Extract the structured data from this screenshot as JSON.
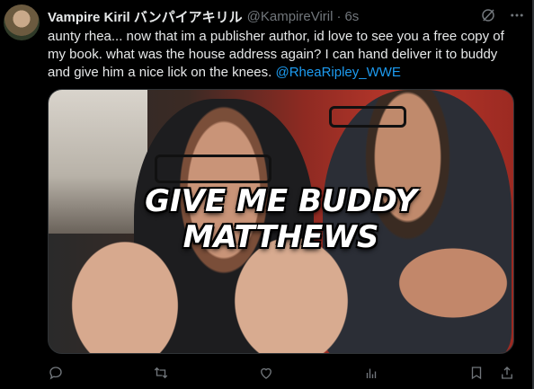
{
  "tweet": {
    "display_name": "Vampire Kiril バンパイアキリル",
    "handle": "@KampireViril",
    "separator": "·",
    "time": "6s",
    "text_main": "aunty rhea... now that im a publisher author, id love to see you a free copy of my book. what was the house address again? I can hand deliver it to buddy and give him a nice lick on the knees. ",
    "mention": "@RheaRipley_WWE"
  },
  "media": {
    "caption": "GIVE ME BUDDY MATTHEWS"
  },
  "icons": {
    "header": [
      "grok-icon",
      "more-icon"
    ],
    "actions": [
      "reply-icon",
      "retweet-icon",
      "like-icon",
      "views-icon",
      "bookmark-icon",
      "share-icon"
    ]
  },
  "colors": {
    "background": "#000000",
    "text": "#e7e9ea",
    "muted": "#71767b",
    "link": "#1d9bf0"
  }
}
